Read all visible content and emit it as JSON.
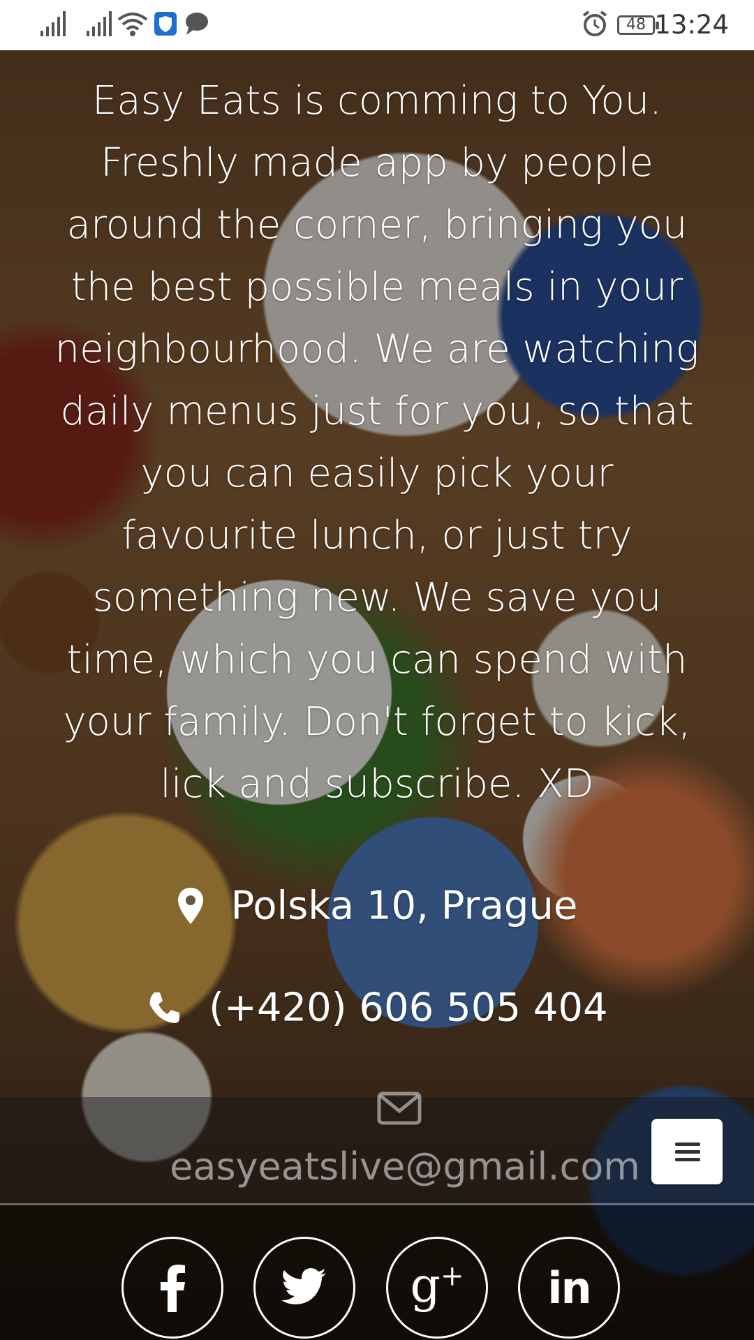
{
  "status_bar": {
    "time": "13:24",
    "battery": "48",
    "icons": [
      "signal-icon",
      "signal-icon",
      "wifi-icon",
      "shield-app-icon",
      "message-icon",
      "alarm-icon",
      "battery-icon"
    ]
  },
  "intro": {
    "text": "Easy Eats is comming to You. Freshly made app by people around the corner, bringing you the best possible meals in your neighbourhood. We are watching daily menus just for you, so that you can easily pick your favourite lunch, or just try something new. We save you time, which you can spend with your family. Don't forget to kick, lick and subscribe. XD"
  },
  "contact": {
    "address": "Polska 10, Prague",
    "phone": "(+420) 606 505 404",
    "email": "easyeatslive@gmail.com"
  },
  "social": [
    {
      "name": "facebook",
      "icon": "facebook-icon"
    },
    {
      "name": "twitter",
      "icon": "twitter-icon"
    },
    {
      "name": "google-plus",
      "icon": "google-plus-icon"
    },
    {
      "name": "linkedin",
      "icon": "linkedin-icon"
    }
  ],
  "menu_button": {
    "icon": "hamburger-menu-icon"
  }
}
